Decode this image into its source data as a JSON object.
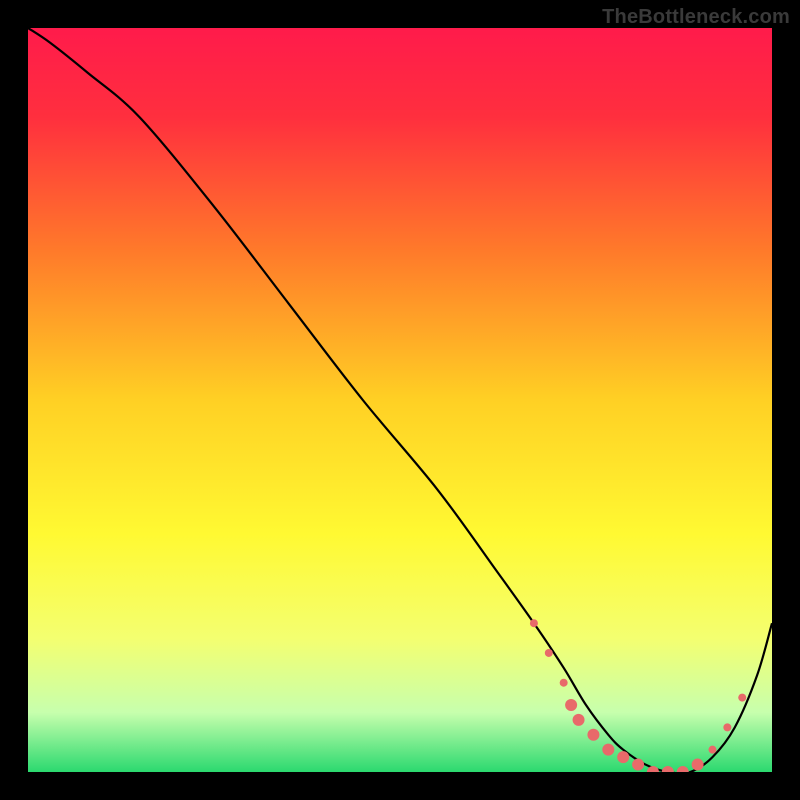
{
  "watermark": "TheBottleneck.com",
  "chart_data": {
    "type": "line",
    "title": "",
    "xlabel": "",
    "ylabel": "",
    "xlim": [
      0,
      100
    ],
    "ylim": [
      0,
      100
    ],
    "grid": false,
    "background_gradient": [
      {
        "stop": 0.0,
        "color": "#ff1b4b"
      },
      {
        "stop": 0.12,
        "color": "#ff2f3e"
      },
      {
        "stop": 0.3,
        "color": "#ff7a2a"
      },
      {
        "stop": 0.5,
        "color": "#ffd024"
      },
      {
        "stop": 0.68,
        "color": "#fff932"
      },
      {
        "stop": 0.82,
        "color": "#f4ff70"
      },
      {
        "stop": 0.92,
        "color": "#c7ffad"
      },
      {
        "stop": 1.0,
        "color": "#2bd96f"
      }
    ],
    "series": [
      {
        "name": "curve",
        "color": "#000000",
        "x": [
          0,
          3,
          8,
          15,
          25,
          35,
          45,
          55,
          63,
          68,
          72,
          75,
          78,
          80,
          83,
          86,
          89,
          92,
          95,
          98,
          100
        ],
        "y": [
          100,
          98,
          94,
          88,
          76,
          63,
          50,
          38,
          27,
          20,
          14,
          9,
          5,
          3,
          1,
          0,
          0,
          2,
          6,
          13,
          20
        ]
      }
    ],
    "markers": {
      "color": "#e86a6a",
      "radius_small": 4,
      "radius_large": 6,
      "points": [
        {
          "x": 68,
          "y": 20,
          "r": "small"
        },
        {
          "x": 70,
          "y": 16,
          "r": "small"
        },
        {
          "x": 72,
          "y": 12,
          "r": "small"
        },
        {
          "x": 73,
          "y": 9,
          "r": "large"
        },
        {
          "x": 74,
          "y": 7,
          "r": "large"
        },
        {
          "x": 76,
          "y": 5,
          "r": "large"
        },
        {
          "x": 78,
          "y": 3,
          "r": "large"
        },
        {
          "x": 80,
          "y": 2,
          "r": "large"
        },
        {
          "x": 82,
          "y": 1,
          "r": "large"
        },
        {
          "x": 84,
          "y": 0,
          "r": "large"
        },
        {
          "x": 86,
          "y": 0,
          "r": "large"
        },
        {
          "x": 88,
          "y": 0,
          "r": "large"
        },
        {
          "x": 90,
          "y": 1,
          "r": "large"
        },
        {
          "x": 92,
          "y": 3,
          "r": "small"
        },
        {
          "x": 94,
          "y": 6,
          "r": "small"
        },
        {
          "x": 96,
          "y": 10,
          "r": "small"
        }
      ]
    }
  }
}
